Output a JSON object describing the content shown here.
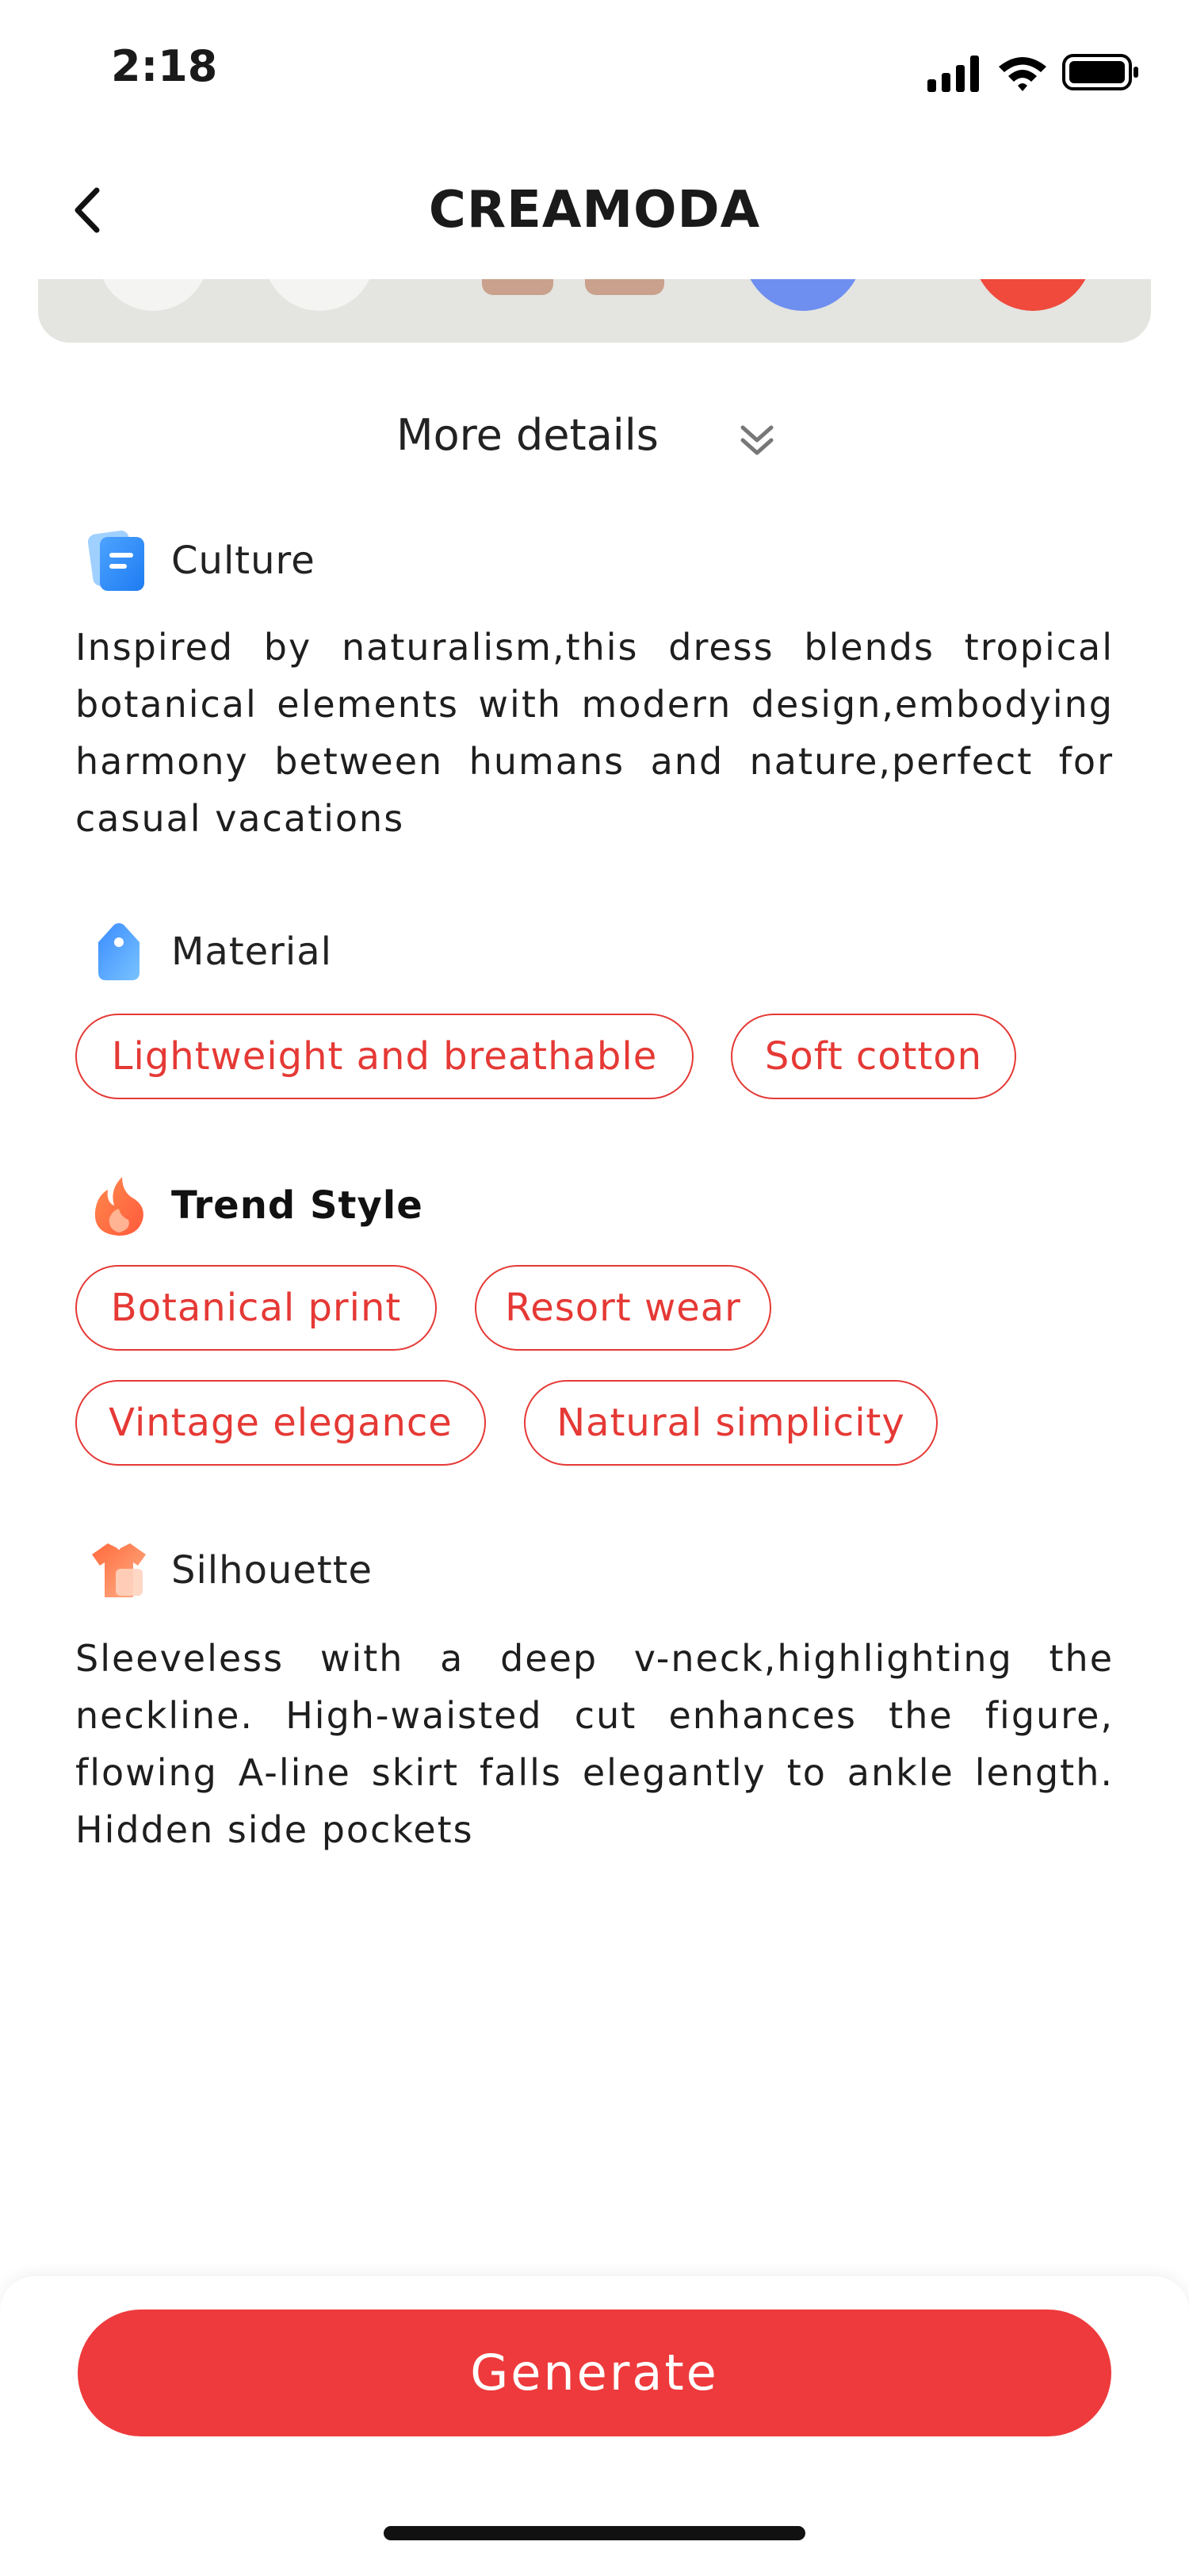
{
  "status_bar": {
    "time": "2:18"
  },
  "header": {
    "title": "CREAMODA"
  },
  "more_details": {
    "label": "More details"
  },
  "sections": {
    "culture": {
      "label": "Culture",
      "text": "Inspired by naturalism,this dress blends tropical botanical elements with modern design,embodying harmony between humans and nature,perfect for casual vacations"
    },
    "material": {
      "label": "Material",
      "tags": [
        "Lightweight and breathable",
        "Soft cotton"
      ]
    },
    "trend_style": {
      "label": "Trend Style",
      "tags": [
        "Botanical print",
        "Resort wear",
        "Vintage elegance",
        "Natural simplicity"
      ]
    },
    "silhouette": {
      "label": "Silhouette",
      "text": "Sleeveless with a deep v-neck,highlighting the neckline. High-waisted cut enhances the figure, flowing A-line skirt falls elegantly to ankle length. Hidden side pockets"
    }
  },
  "footer": {
    "generate_label": "Generate"
  },
  "colors": {
    "accent": "#ee3a3c",
    "tag_border": "#e53935"
  }
}
